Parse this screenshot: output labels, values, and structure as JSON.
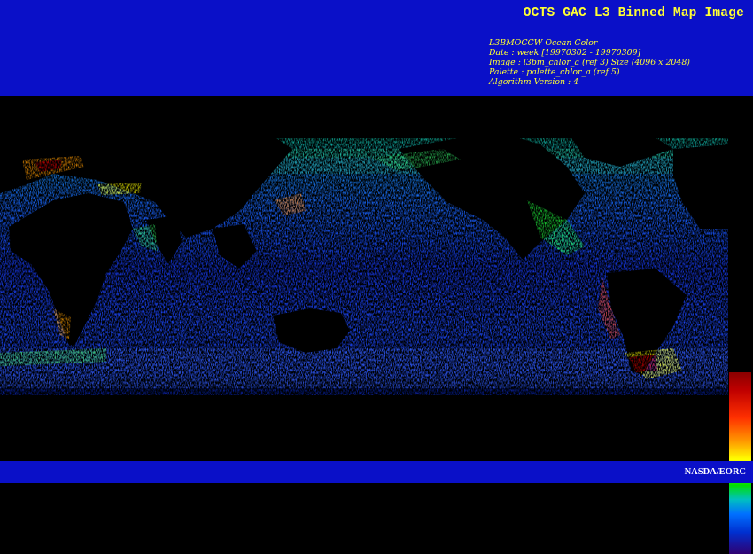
{
  "header": {
    "title": "OCTS GAC L3 Binned Map Image",
    "meta_lines": [
      "L3BMOCCW Ocean Color",
      "Date : week [19970302 - 19970309]",
      "Image : l3bm_chlor_a (ref 3) Size (4096 x 2048)",
      "Palette : palette_chlor_a (ref 5)",
      "Algorithm Version : 4"
    ]
  },
  "footer": {
    "credit": "NASDA/EORC"
  },
  "colors": {
    "banner": "#0a10c8",
    "title_text": "#ffff33",
    "ocean_low": "#1c3cff",
    "ocean_high": "#8b0000",
    "land": "#000000"
  },
  "colorbar": {
    "orientation": "vertical",
    "scale": [
      "dark-red",
      "red",
      "orange",
      "yellow",
      "green",
      "cyan",
      "blue",
      "dark-violet"
    ]
  }
}
